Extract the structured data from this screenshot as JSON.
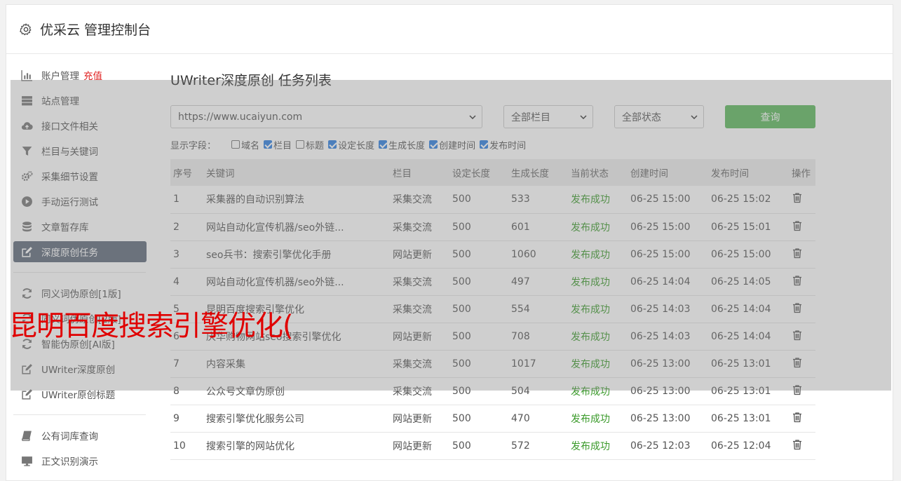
{
  "header": {
    "title": "优采云 管理控制台"
  },
  "sidebar": {
    "groups": [
      [
        {
          "label": "账户管理",
          "extra": "充值",
          "icon": "bar-chart-icon"
        },
        {
          "label": "站点管理",
          "icon": "server-icon"
        },
        {
          "label": "接口文件相关",
          "icon": "cloud-upload-icon"
        },
        {
          "label": "栏目与关键词",
          "icon": "filter-icon"
        },
        {
          "label": "采集细节设置",
          "icon": "gears-icon"
        },
        {
          "label": "手动运行测试",
          "icon": "play-circle-icon"
        },
        {
          "label": "文章暂存库",
          "icon": "database-icon"
        },
        {
          "label": "深度原创任务",
          "icon": "edit-icon",
          "active": true
        }
      ],
      [
        {
          "label": "同义词伪原创[1版]",
          "icon": "refresh-icon"
        },
        {
          "label": "同义词伪原创[2版]",
          "icon": "refresh-icon"
        },
        {
          "label": "智能伪原创[AI版]",
          "icon": "refresh-icon"
        },
        {
          "label": "UWriter深度原创",
          "icon": "edit-icon"
        },
        {
          "label": "UWriter原创标题",
          "icon": "edit-icon"
        }
      ],
      [
        {
          "label": "公有词库查询",
          "icon": "book-icon"
        },
        {
          "label": "正文识别演示",
          "icon": "monitor-icon"
        }
      ]
    ]
  },
  "main": {
    "title": "UWriter深度原创 任务列表",
    "site_select": "https://www.ucaiyun.com",
    "column_select": "全部栏目",
    "status_select": "全部状态",
    "query_label": "查询",
    "fields_label": "显示字段：",
    "fields": [
      {
        "label": "域名",
        "checked": false
      },
      {
        "label": "栏目",
        "checked": true
      },
      {
        "label": "标题",
        "checked": false
      },
      {
        "label": "设定长度",
        "checked": true
      },
      {
        "label": "生成长度",
        "checked": true
      },
      {
        "label": "创建时间",
        "checked": true
      },
      {
        "label": "发布时间",
        "checked": true
      }
    ],
    "columns": [
      "序号",
      "关键词",
      "栏目",
      "设定长度",
      "生成长度",
      "当前状态",
      "创建时间",
      "发布时间",
      "操作"
    ],
    "rows": [
      [
        "1",
        "采集器的自动识别算法",
        "采集交流",
        "500",
        "533",
        "发布成功",
        "06-25 15:00",
        "06-25 15:02"
      ],
      [
        "2",
        "网站自动化宣传机器/seo外链...",
        "采集交流",
        "500",
        "601",
        "发布成功",
        "06-25 15:00",
        "06-25 15:01"
      ],
      [
        "3",
        "seo兵书：搜索引擎优化手册",
        "网站更新",
        "500",
        "1060",
        "发布成功",
        "06-25 15:00",
        "06-25 15:00"
      ],
      [
        "4",
        "网站自动化宣传机器/seo外链...",
        "采集交流",
        "500",
        "497",
        "发布成功",
        "06-25 14:04",
        "06-25 14:05"
      ],
      [
        "5",
        "昆明百度搜索引擎优化",
        "采集交流",
        "500",
        "554",
        "发布成功",
        "06-25 14:03",
        "06-25 14:04"
      ],
      [
        "6",
        "庆华购物网站seo搜索引擎优化",
        "网站更新",
        "500",
        "708",
        "发布成功",
        "06-25 14:03",
        "06-25 14:04"
      ],
      [
        "7",
        "内容采集",
        "采集交流",
        "500",
        "1017",
        "发布成功",
        "06-25 13:00",
        "06-25 13:01"
      ],
      [
        "8",
        "公众号文章伪原创",
        "采集交流",
        "500",
        "504",
        "发布成功",
        "06-25 13:00",
        "06-25 13:01"
      ],
      [
        "9",
        "搜索引擎优化服务公司",
        "网站更新",
        "500",
        "470",
        "发布成功",
        "06-25 13:00",
        "06-25 13:01"
      ],
      [
        "10",
        "搜索引擎的网站优化",
        "网站更新",
        "500",
        "572",
        "发布成功",
        "06-25 12:03",
        "06-25 12:04"
      ]
    ]
  },
  "overlay_text": "昆明百度搜索引擎优化(",
  "colors": {
    "active_nav": "#5e6a7a",
    "query_button": "#5cb85c",
    "status_ok": "#3a9a2a",
    "overlay_text": "#e00000"
  }
}
